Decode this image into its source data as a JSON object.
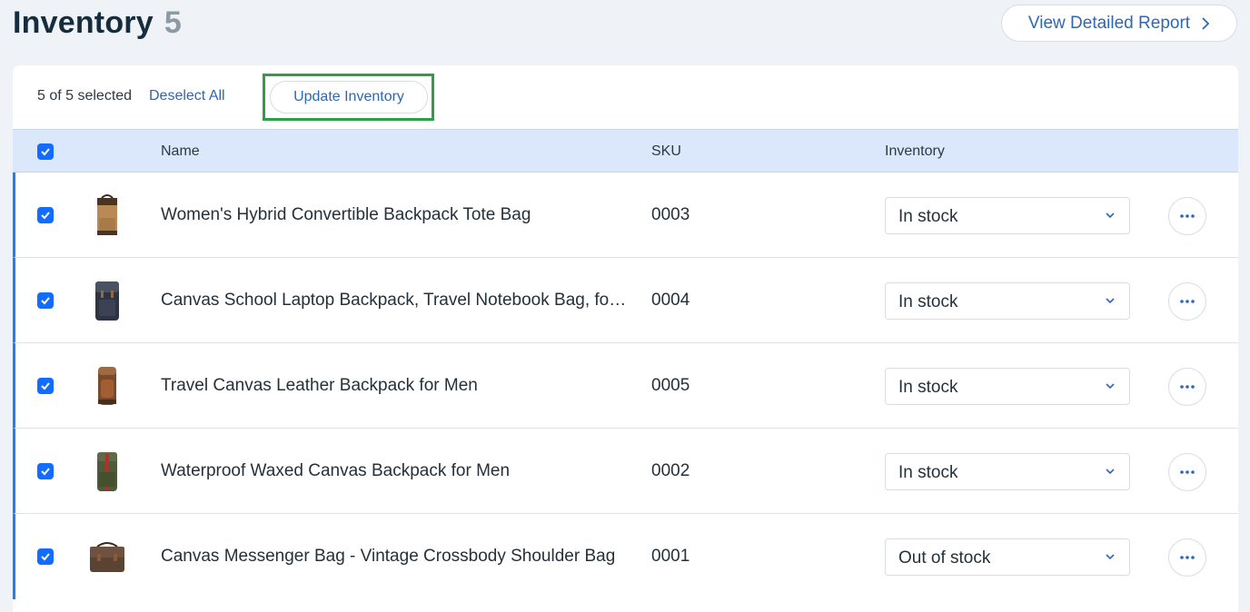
{
  "page": {
    "title": "Inventory",
    "count": "5"
  },
  "report_button": {
    "label": "View Detailed Report"
  },
  "toolbar": {
    "selected_text": "5 of 5 selected",
    "deselect_label": "Deselect All",
    "update_label": "Update Inventory"
  },
  "table": {
    "headers": {
      "name": "Name",
      "sku": "SKU",
      "inventory": "Inventory"
    },
    "rows": [
      {
        "name": "Women's Hybrid Convertible Backpack Tote Bag",
        "sku": "0003",
        "inventory": "In stock",
        "checked": true,
        "thumb": "tan-backpack"
      },
      {
        "name": "Canvas School Laptop Backpack, Travel Notebook Bag, fo…",
        "sku": "0004",
        "inventory": "In stock",
        "checked": true,
        "thumb": "navy-backpack"
      },
      {
        "name": "Travel Canvas Leather Backpack for Men",
        "sku": "0005",
        "inventory": "In stock",
        "checked": true,
        "thumb": "brown-backpack"
      },
      {
        "name": "Waterproof Waxed Canvas Backpack for Men",
        "sku": "0002",
        "inventory": "In stock",
        "checked": true,
        "thumb": "olive-backpack"
      },
      {
        "name": "Canvas Messenger Bag - Vintage Crossbody Shoulder Bag",
        "sku": "0001",
        "inventory": "Out of stock",
        "checked": true,
        "thumb": "brown-messenger"
      }
    ]
  },
  "colors": {
    "accent": "#116dff",
    "highlight_border": "#2e9e48",
    "header_bg": "#dbe8fb"
  }
}
